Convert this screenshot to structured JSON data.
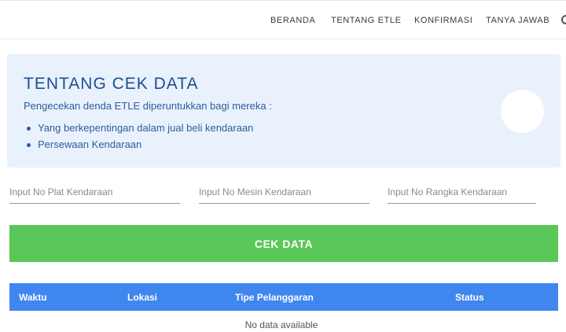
{
  "nav": {
    "items": [
      "BERANDA",
      "TENTANG ETLE",
      "KONFIRMASI",
      "TANYA JAWAB"
    ]
  },
  "info": {
    "title": "TENTANG CEK DATA",
    "subtitle": "Pengecekan denda ETLE diperuntukkan bagi mereka :",
    "bullets": [
      "Yang berkepentingan dalam jual beli kendaraan",
      "Persewaan Kendaraan"
    ]
  },
  "form": {
    "plat_placeholder": "Input No Plat Kendaraan",
    "mesin_placeholder": "Input No Mesin Kendaraan",
    "rangka_placeholder": "Input No Rangka Kendaraan",
    "plat_value": "",
    "mesin_value": "",
    "rangka_value": "",
    "submit_label": "CEK DATA"
  },
  "table": {
    "columns": [
      "Waktu",
      "Lokasi",
      "Tipe Pelanggaran",
      "Status"
    ],
    "empty_text": "No data available",
    "rows": []
  },
  "colors": {
    "info_bg": "#e9f1fd",
    "title": "#1f4e8f",
    "button": "#5ac759",
    "table_header": "#3f86ee"
  }
}
